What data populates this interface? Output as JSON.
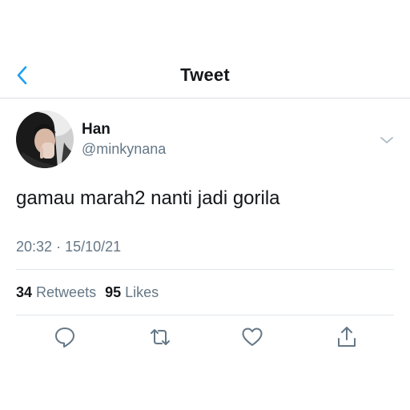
{
  "nav": {
    "title": "Tweet",
    "back_icon": "chevron-left-icon"
  },
  "author": {
    "display_name": "Han",
    "handle": "@minkynana"
  },
  "tweet": {
    "text": "gamau marah2 nanti jadi gorila",
    "time": "20:32",
    "separator": "·",
    "date": "15/10/21"
  },
  "stats": {
    "retweets_count": "34",
    "retweets_label": "Retweets",
    "likes_count": "95",
    "likes_label": "Likes"
  },
  "actions": [
    "reply-icon",
    "retweet-icon",
    "like-icon",
    "share-icon"
  ],
  "colors": {
    "accent": "#1da1f2",
    "text": "#14171a",
    "secondary": "#657786",
    "icon": "#657786",
    "divider": "#e1e8ed"
  }
}
